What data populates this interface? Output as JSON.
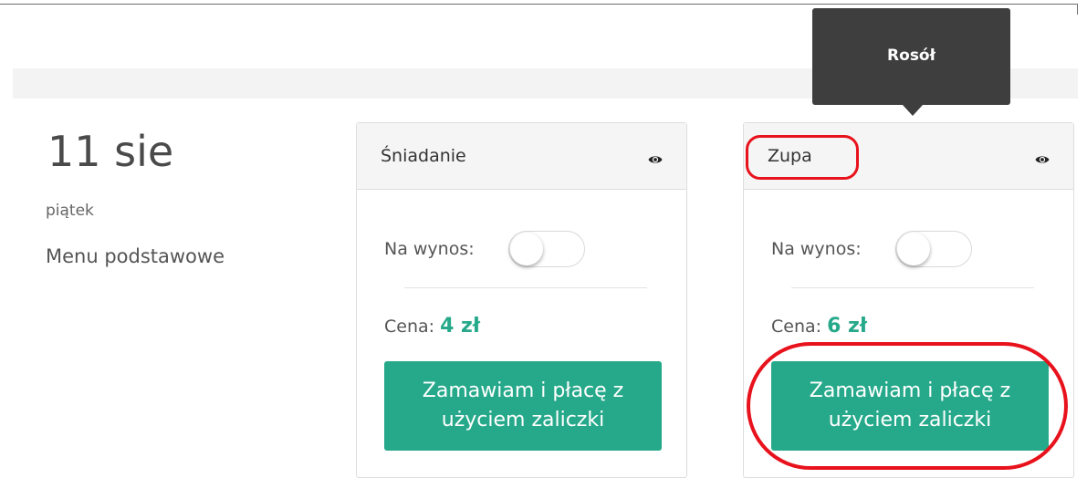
{
  "day": {
    "date": "11 sie",
    "weekday": "piątek",
    "menu_name": "Menu podstawowe"
  },
  "tooltip": {
    "text": "Rosół"
  },
  "meals": [
    {
      "title": "Śniadanie",
      "takeaway_label": "Na wynos:",
      "takeaway_on": false,
      "price_label": "Cena:",
      "price_value": "4 zł",
      "order_button": "Zamawiam i płacę z użyciem zaliczki"
    },
    {
      "title": "Zupa",
      "takeaway_label": "Na wynos:",
      "takeaway_on": false,
      "price_label": "Cena:",
      "price_value": "6 zł",
      "order_button": "Zamawiam i płacę z użyciem zaliczki"
    }
  ],
  "icons": [
    "eye-icon",
    "eye-icon"
  ],
  "colors": {
    "accent": "#26a98a",
    "highlight": "#e8121c",
    "tooltip": "#3e3e3e"
  }
}
